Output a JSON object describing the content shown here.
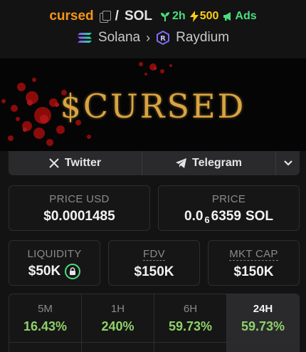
{
  "header": {
    "token_name": "cursed",
    "separator": "/",
    "quote_symbol": "SOL",
    "age": "2h",
    "boosts": "500",
    "ads_label": "Ads",
    "chain": "Solana",
    "dex": "Raydium"
  },
  "banner": {
    "text": "$CURSED"
  },
  "social": {
    "twitter_label": "Twitter",
    "telegram_label": "Telegram"
  },
  "stats": {
    "price_usd": {
      "label": "PRICE USD",
      "value": "$0.0001485"
    },
    "price_native": {
      "label": "PRICE",
      "prefix": "0.0",
      "subscript": "6",
      "digits": "6359",
      "unit": "SOL"
    },
    "liquidity": {
      "label": "LIQUIDITY",
      "value": "$50K"
    },
    "fdv": {
      "label": "FDV",
      "value": "$150K"
    },
    "mkt_cap": {
      "label": "MKT CAP",
      "value": "$150K"
    }
  },
  "timeframes": [
    {
      "label": "5M",
      "value": "16.43%"
    },
    {
      "label": "1H",
      "value": "240%"
    },
    {
      "label": "6H",
      "value": "59.73%"
    },
    {
      "label": "24H",
      "value": "59.73%",
      "selected": true
    }
  ],
  "colors": {
    "accent_orange": "#f7931a",
    "positive_green": "#8fd16a",
    "boost_yellow": "#facc15",
    "banner_gold": "#d9a441",
    "blood_red": "#8b0b0b"
  }
}
